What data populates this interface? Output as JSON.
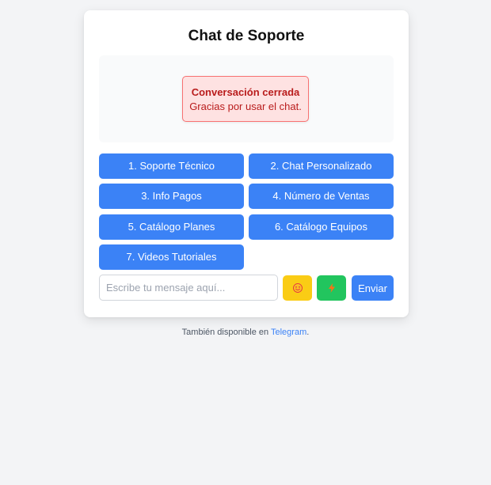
{
  "chat": {
    "title": "Chat de Soporte",
    "status": {
      "title": "Conversación cerrada",
      "message": "Gracias por usar el chat."
    },
    "options": [
      "1. Soporte Técnico",
      "2. Chat Personalizado",
      "3. Info Pagos",
      "4. Número de Ventas",
      "5. Catálogo Planes",
      "6. Catálogo Equipos",
      "7. Videos Tutoriales"
    ],
    "input": {
      "placeholder": "Escribe tu mensaje aquí...",
      "value": ""
    },
    "emoji_button": {
      "icon": "smiley-icon",
      "color": "#facc15"
    },
    "quick_button": {
      "icon": "lightning-icon",
      "color": "#22c55e"
    },
    "send_label": "Enviar"
  },
  "footer": {
    "text": "También disponible en ",
    "link_label": "Telegram",
    "suffix": "."
  },
  "colors": {
    "background": "#f3f4f6",
    "accent": "#3b82f6",
    "error_bg": "#fee2e2",
    "error_border": "#f87171",
    "error_text": "#b91c1c"
  }
}
